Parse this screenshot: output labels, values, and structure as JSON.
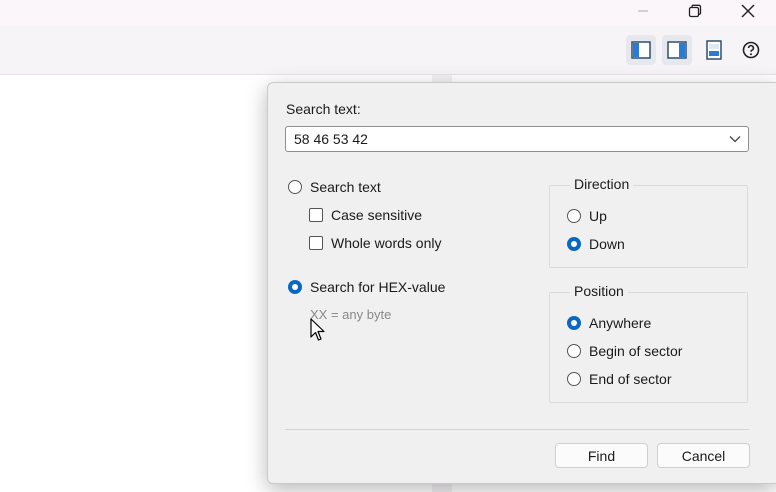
{
  "window": {
    "minimize_icon": "minimize-icon",
    "maximize_icon": "restore-icon",
    "close_icon": "close-icon"
  },
  "toolbar": {
    "buttons": [
      {
        "icon": "left-pane-icon",
        "active": true
      },
      {
        "icon": "right-pane-icon",
        "active": true
      },
      {
        "icon": "document-icon",
        "active": false
      },
      {
        "icon": "help-icon",
        "active": false
      }
    ]
  },
  "dialog": {
    "search_label": "Search text:",
    "search_value": "58 46 53 42",
    "mode_text": "Search text",
    "case_sensitive": "Case sensitive",
    "whole_words": "Whole words only",
    "mode_hex": "Search for HEX-value",
    "hex_hint": "XX = any byte",
    "selected_mode": "hex",
    "direction": {
      "title": "Direction",
      "up": "Up",
      "down": "Down",
      "selected": "down"
    },
    "position": {
      "title": "Position",
      "anywhere": "Anywhere",
      "begin": "Begin of sector",
      "end": "End of sector",
      "selected": "anywhere"
    },
    "find_label": "Find",
    "cancel_label": "Cancel"
  },
  "colors": {
    "accent": "#0a67c4",
    "dialog_bg": "#f0f0f0",
    "hint": "#8a8a8a"
  }
}
